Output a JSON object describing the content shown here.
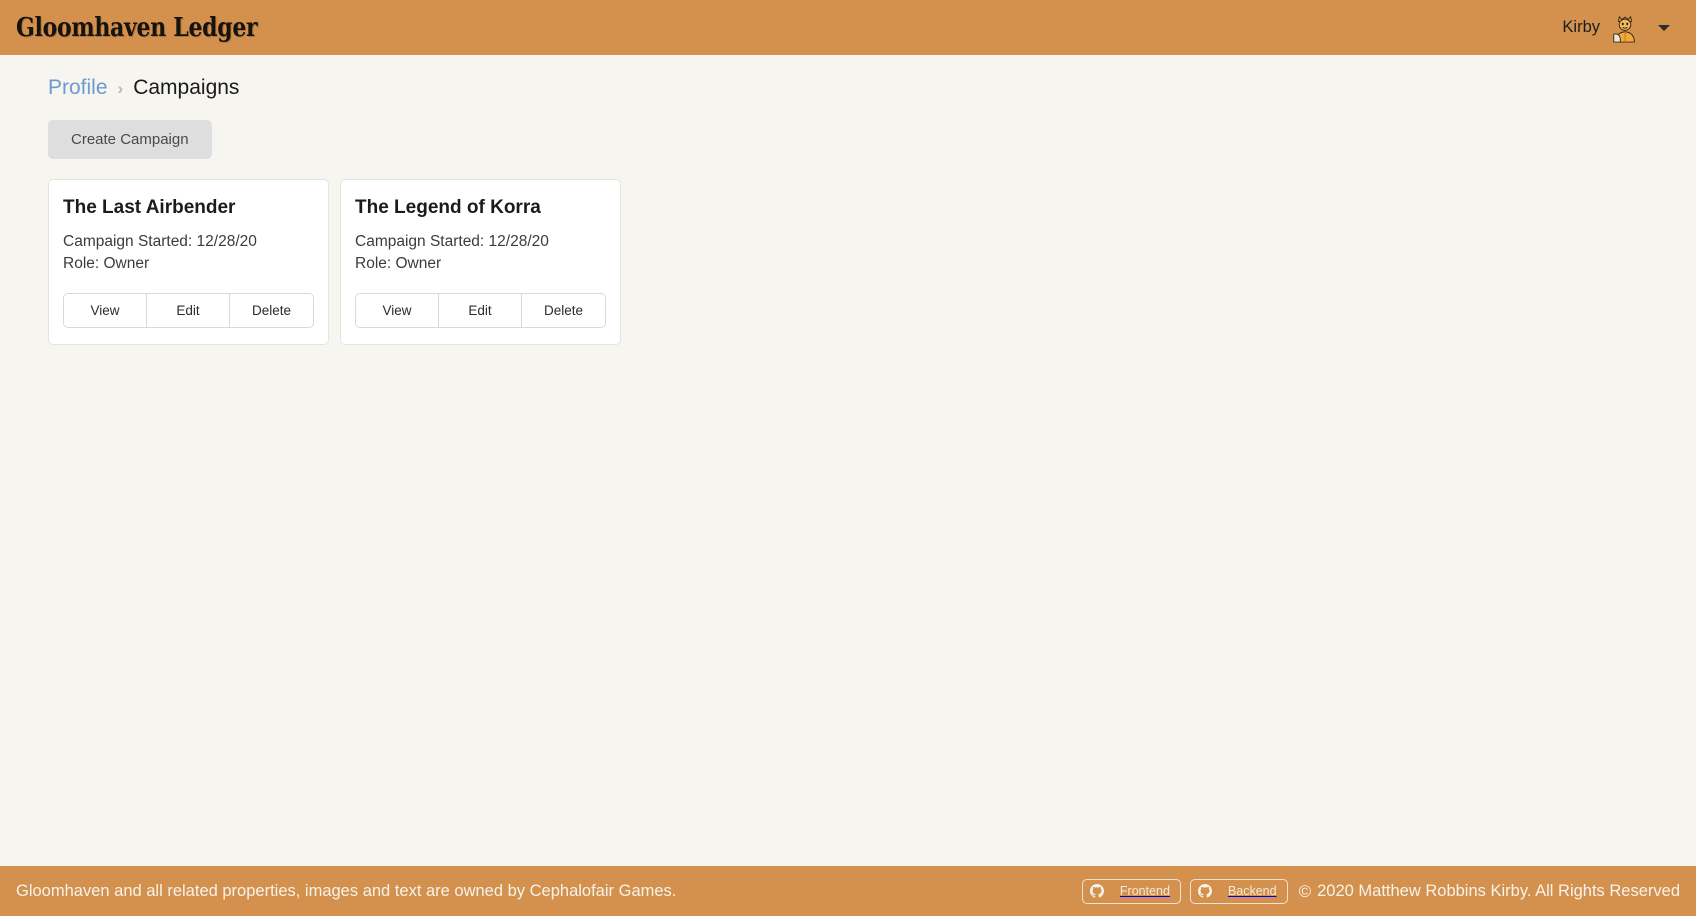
{
  "header": {
    "brand": "Gloomhaven Ledger",
    "user_name": "Kirby",
    "avatar_icon": "character-portrait-icon",
    "caret_icon": "chevron-down-icon",
    "background_color": "#D3914D"
  },
  "breadcrumb": {
    "parent_label": "Profile",
    "separator": "›",
    "current_label": "Campaigns"
  },
  "toolbar": {
    "create_label": "Create Campaign"
  },
  "campaigns": [
    {
      "title": "The Last Airbender",
      "started_label": "Campaign Started: 12/28/20",
      "role_label": "Role: Owner",
      "actions": [
        "View",
        "Edit",
        "Delete"
      ]
    },
    {
      "title": "The Legend of Korra",
      "started_label": "Campaign Started: 12/28/20",
      "role_label": "Role: Owner",
      "actions": [
        "View",
        "Edit",
        "Delete"
      ]
    }
  ],
  "footer": {
    "attribution": "Gloomhaven and all related properties, images and text are owned by Cephalofair Games.",
    "badges": [
      {
        "label": "Frontend",
        "icon": "github-icon"
      },
      {
        "label": "Backend",
        "icon": "github-icon"
      }
    ],
    "copyright_mark": "©",
    "copyright": "2020 Matthew Robbins Kirby. All Rights Reserved",
    "background_color": "#D3914D"
  },
  "colors": {
    "accent": "#D3914D",
    "page_background": "#F7F5F0",
    "card_background": "#FFFFFF",
    "link": "#6C9BD2"
  }
}
